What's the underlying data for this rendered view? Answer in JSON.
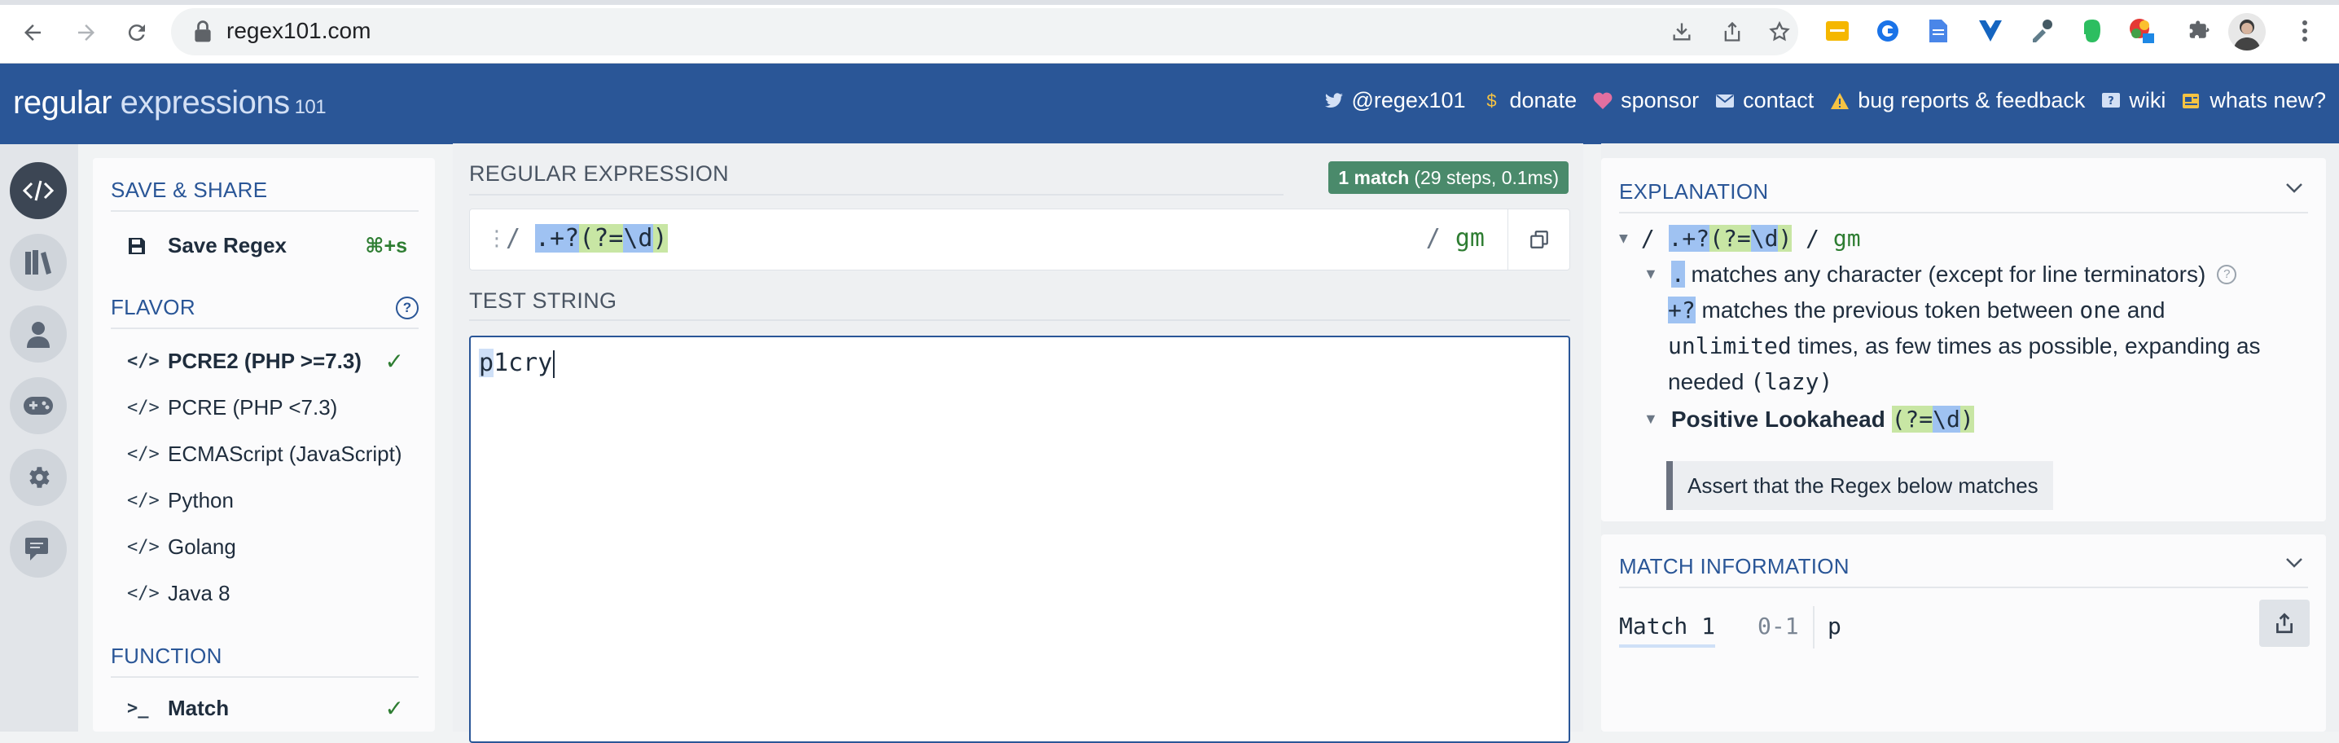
{
  "browser": {
    "url": "regex101.com"
  },
  "site": {
    "logo_part1": "regular",
    "logo_part2": " expressions",
    "logo_part3": "101",
    "links": [
      {
        "icon": "twitter-icon",
        "label": "@regex101"
      },
      {
        "icon": "dollar-icon",
        "label": "donate"
      },
      {
        "icon": "heart-icon",
        "label": "sponsor"
      },
      {
        "icon": "mail-icon",
        "label": "contact"
      },
      {
        "icon": "warning-icon",
        "label": "bug reports & feedback"
      },
      {
        "icon": "help-icon",
        "label": "wiki"
      },
      {
        "icon": "news-icon",
        "label": "whats new?"
      }
    ]
  },
  "sidebar": {
    "save_share_title": "SAVE & SHARE",
    "save_label": "Save Regex",
    "save_shortcut": "⌘+s",
    "flavor_title": "FLAVOR",
    "flavors": [
      {
        "code": "</>",
        "label": "PCRE2 (PHP >=7.3)",
        "selected": true
      },
      {
        "code": "</>",
        "label": "PCRE (PHP <7.3)",
        "selected": false
      },
      {
        "code": "</>",
        "label": "ECMAScript (JavaScript)",
        "selected": false
      },
      {
        "code": "</>",
        "label": "Python",
        "selected": false
      },
      {
        "code": "</>",
        "label": "Golang",
        "selected": false
      },
      {
        "code": "</>",
        "label": "Java 8",
        "selected": false
      }
    ],
    "function_title": "FUNCTION",
    "function_code": ">_",
    "function_label": "Match"
  },
  "main": {
    "regex_title": "REGULAR EXPRESSION",
    "match_badge_strong": "1 match",
    "match_badge_rest": "(29 steps, 0.1ms)",
    "delimiter": "/",
    "pattern_dotlazy": ".+?",
    "pattern_lookopen": "(?=",
    "pattern_digit": "\\d",
    "pattern_close": ")",
    "flags_slash": "/",
    "flags": "gm",
    "test_title": "TEST STRING",
    "test_match": "p",
    "test_rest": "1cry"
  },
  "explanation": {
    "title": "EXPLANATION",
    "root_slash1": "/",
    "root_dotlazy": ".+?",
    "root_look": "(?=",
    "root_digit": "\\d",
    "root_close": ")",
    "root_slash2": "/",
    "root_flags": "gm",
    "dot_token": ".",
    "dot_text": "matches any character (except for line terminators)",
    "lazy_token": "+?",
    "lazy_text1": "matches the previous token between",
    "lazy_one": "one",
    "lazy_and": "and",
    "lazy_unlimited": "unlimited",
    "lazy_text2": "times, as few times as possible, expanding as",
    "lazy_text3": "needed",
    "lazy_paren": "(lazy)",
    "lookahead_label": "Positive Lookahead",
    "lookahead_open": "(?=",
    "lookahead_digit": "\\d",
    "lookahead_close": ")",
    "assert_text": "Assert that the Regex below matches"
  },
  "match_info": {
    "title": "MATCH INFORMATION",
    "match_label": "Match 1",
    "match_range": "0-1",
    "match_value": "p"
  },
  "colors": {
    "header_blue": "#2a5697",
    "match_green": "#4a8a6b",
    "highlight_blue": "#9fc2f2",
    "highlight_green": "#c8e6a4"
  }
}
